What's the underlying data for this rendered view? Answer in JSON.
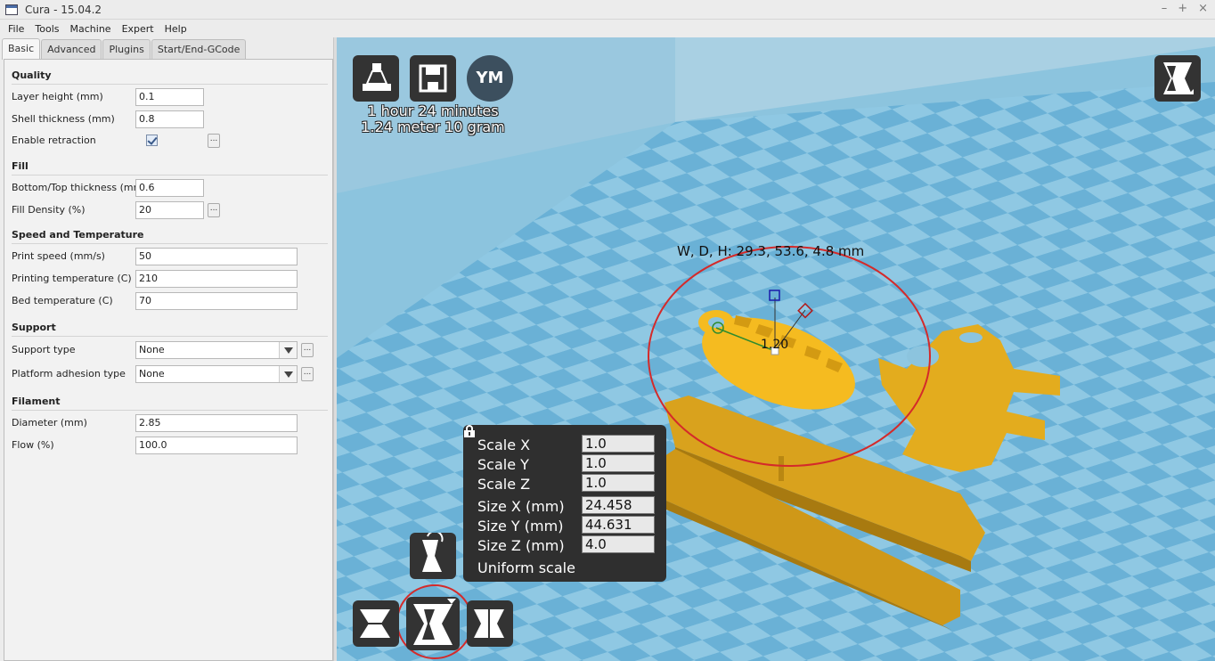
{
  "window": {
    "title": "Cura - 15.04.2"
  },
  "menu": [
    "File",
    "Tools",
    "Machine",
    "Expert",
    "Help"
  ],
  "tabs": [
    "Basic",
    "Advanced",
    "Plugins",
    "Start/End-GCode"
  ],
  "settings": {
    "quality": {
      "title": "Quality",
      "layer_height_label": "Layer height (mm)",
      "layer_height": "0.1",
      "shell_label": "Shell thickness (mm)",
      "shell": "0.8",
      "retraction_label": "Enable retraction"
    },
    "fill": {
      "title": "Fill",
      "bottom_top_label": "Bottom/Top thickness (mm)",
      "bottom_top": "0.6",
      "density_label": "Fill Density (%)",
      "density": "20"
    },
    "speed": {
      "title": "Speed and Temperature",
      "print_speed_label": "Print speed (mm/s)",
      "print_speed": "50",
      "print_temp_label": "Printing temperature (C)",
      "print_temp": "210",
      "bed_temp_label": "Bed temperature (C)",
      "bed_temp": "70"
    },
    "support": {
      "title": "Support",
      "type_label": "Support type",
      "type": "None",
      "adhesion_label": "Platform adhesion type",
      "adhesion": "None"
    },
    "filament": {
      "title": "Filament",
      "diameter_label": "Diameter (mm)",
      "diameter": "2.85",
      "flow_label": "Flow (%)",
      "flow": "100.0"
    },
    "more_button": "..."
  },
  "viewport": {
    "print_time": "1 hour 24 minutes",
    "print_usage": "1.24 meter 10 gram",
    "ym_button": "YM",
    "dimensions": "W, D, H: 29.3, 53.6, 4.8 mm",
    "scale_handle_value": "1.20",
    "scale_panel": {
      "scale_x_label": "Scale X",
      "scale_x": "1.0",
      "scale_y_label": "Scale Y",
      "scale_y": "1.0",
      "scale_z_label": "Scale Z",
      "scale_z": "1.0",
      "size_x_label": "Size X (mm)",
      "size_x": "24.458",
      "size_y_label": "Size Y (mm)",
      "size_y": "44.631",
      "size_z_label": "Size Z (mm)",
      "size_z": "4.0",
      "uniform_label": "Uniform scale"
    }
  },
  "colors": {
    "model": "#f2b91e",
    "bed": "#8cc4de",
    "highlight_circle": "#d42a2a"
  }
}
